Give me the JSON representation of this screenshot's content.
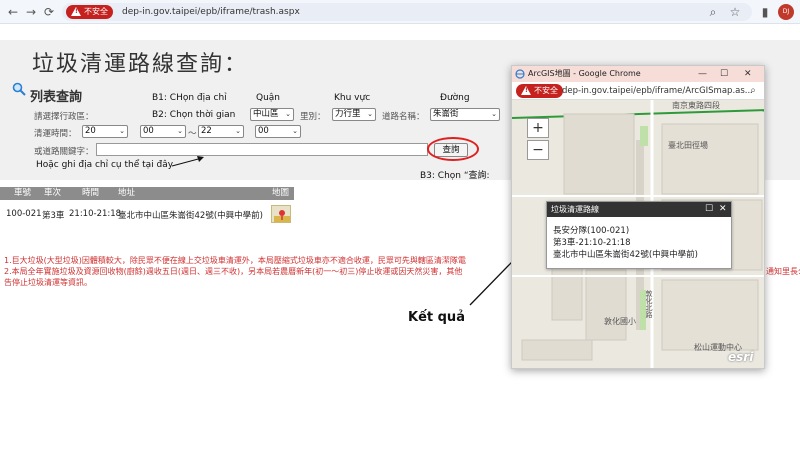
{
  "browser": {
    "security_label": "不安全",
    "url": "dep-in.gov.taipei/epb/iframe/trash.aspx",
    "avatar_initials": "DJ"
  },
  "page": {
    "title": "垃圾清運路線查詢：",
    "section_title": "列表查詢",
    "labels": {
      "district": "請選擇行政區：",
      "village": "里別：",
      "road": "道路名稱：",
      "time": "清運時間：",
      "time_sep": "～",
      "keyword": "或道路關鍵字："
    },
    "selects": {
      "district": "中山區",
      "village": "力行里",
      "road": "朱崙街",
      "start_hour": "20",
      "start_minute": "00",
      "end_hour": "22",
      "end_minute": "00"
    },
    "query_button": "查詢",
    "table": {
      "headers": [
        "車號",
        "車次",
        "時間",
        "地址",
        "地圖"
      ],
      "rows": [
        {
          "car_no": "100-021",
          "trip": "第3車",
          "time": "21:10-21:18",
          "address": "臺北市中山區朱崙街42號(中興中學前)"
        }
      ]
    },
    "notices": [
      "1.巨大垃圾(大型垃圾)因體積較大，除民眾不便在線上交垃圾車清運外，本局壓縮式垃圾車亦不適合收運，民眾可先與轄區清潔隊電",
      "2.本局全年實施垃圾及資源回收物(廚餘)週收五日(週日、週三不收)，另本局若農曆新年(初一～初三)停止收運或因天然災害，其他",
      "告停止垃圾清運等資訊。"
    ],
    "notice_tail": "通知里長公"
  },
  "annotations": {
    "step1": "B1: CHọn địa chỉ",
    "step2": "B2: Chọn thời gian",
    "quan": "Quận",
    "khu_vuc": "Khu vực",
    "duong": "Đường",
    "address_hint": "Hoặc ghi địa chỉ cụ thể tại đây",
    "step3": "B3: Chọn “查詢:",
    "result": "Kết quả"
  },
  "popup": {
    "window_title": "ArcGIS地圖 - Google Chrome",
    "security_label": "不安全",
    "url": "dep-in.gov.taipei/epb/iframe/ArcGISmap.as...",
    "zoom_in": "+",
    "zoom_out": "−",
    "info": {
      "title": "垃圾清運路線",
      "line1": "長安分隊(100-021)",
      "line2": "第3車-21:10-21:18",
      "line3": "臺北市中山區朱崙街42號(中興中學前)"
    },
    "map_labels": {
      "road": "南京東路四段",
      "park": "臺北田徑場",
      "school": "敦化國小",
      "park2": "松山運動中心",
      "lane": "敦化北路"
    },
    "attribution": "esri"
  },
  "colors": {
    "alert_red": "#c5221f",
    "notice_red": "#d03030",
    "circle_red": "#e02020"
  }
}
